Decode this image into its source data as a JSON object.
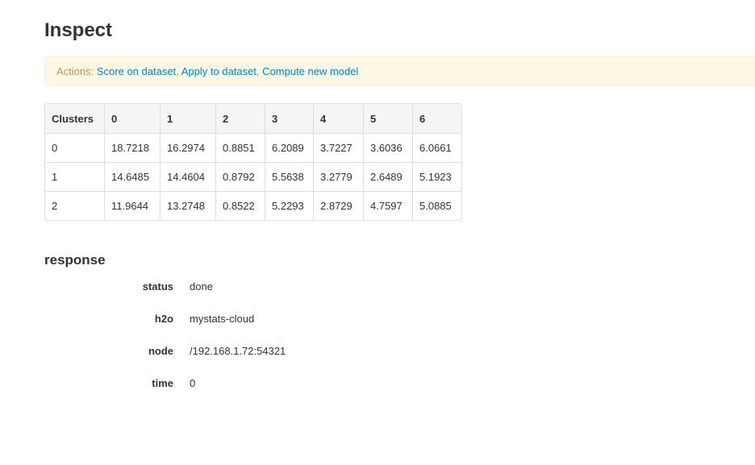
{
  "title": "Inspect",
  "actions": {
    "label": "Actions:",
    "links": [
      "Score on dataset",
      "Apply to dataset",
      "Compute new model"
    ]
  },
  "table": {
    "headers": [
      "Clusters",
      "0",
      "1",
      "2",
      "3",
      "4",
      "5",
      "6"
    ],
    "rows": [
      [
        "0",
        "18.7218",
        "16.2974",
        "0.8851",
        "6.2089",
        "3.7227",
        "3.6036",
        "6.0661"
      ],
      [
        "1",
        "14.6485",
        "14.4604",
        "0.8792",
        "5.5638",
        "3.2779",
        "2.6489",
        "5.1923"
      ],
      [
        "2",
        "11.9644",
        "13.2748",
        "0.8522",
        "5.2293",
        "2.8729",
        "4.7597",
        "5.0885"
      ]
    ]
  },
  "response": {
    "title": "response",
    "items": [
      {
        "key": "status",
        "value": "done"
      },
      {
        "key": "h2o",
        "value": "mystats-cloud"
      },
      {
        "key": "node",
        "value": "/192.168.1.72:54321"
      },
      {
        "key": "time",
        "value": "0"
      }
    ]
  }
}
